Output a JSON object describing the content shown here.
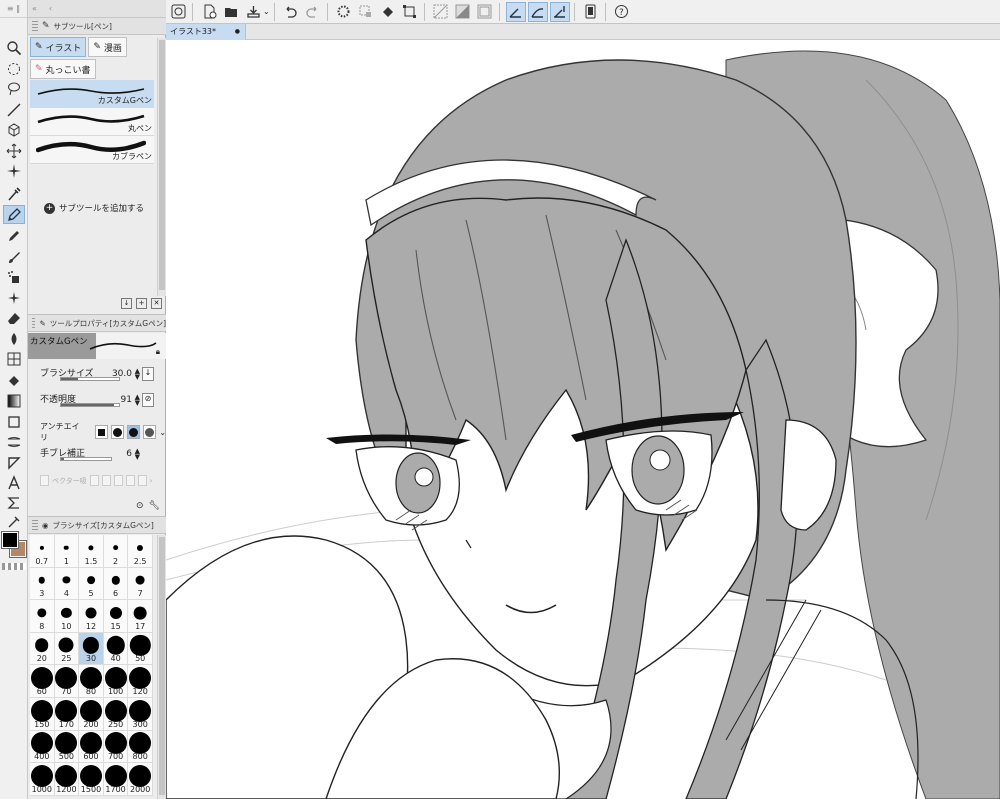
{
  "subtool_panel": {
    "title": "サブツール[ペン]",
    "tabs": [
      {
        "label": "イラスト"
      },
      {
        "label": "漫画"
      },
      {
        "label": "丸っこい書"
      }
    ],
    "brushes": [
      {
        "label": "カスタムGペン"
      },
      {
        "label": "丸ペン"
      },
      {
        "label": "カブラペン"
      }
    ],
    "add_label": "サブツールを追加する"
  },
  "tool_property": {
    "title": "ツールプロパティ[カスタムGペン]",
    "brush_name": "カスタムGペン",
    "brush_size": {
      "label": "ブラシサイズ",
      "value": "30.0",
      "fill": 0.3
    },
    "opacity": {
      "label": "不透明度",
      "value": "91",
      "fill": 0.91
    },
    "antialias": {
      "label": "アンチエイリ"
    },
    "stabilization": {
      "label": "手ブレ補正",
      "value": "6"
    },
    "vector": {
      "label": "ベクター吸"
    }
  },
  "brush_size_panel": {
    "title": "ブラシサイズ[カスタムGペン]",
    "sizes": [
      "0.7",
      "1",
      "1.5",
      "2",
      "2.5",
      "3",
      "4",
      "5",
      "6",
      "7",
      "8",
      "10",
      "12",
      "15",
      "17",
      "20",
      "25",
      "30",
      "40",
      "50",
      "60",
      "70",
      "80",
      "100",
      "120",
      "150",
      "170",
      "200",
      "250",
      "300",
      "400",
      "500",
      "600",
      "700",
      "800",
      "1000",
      "1200",
      "1500",
      "1700",
      "2000"
    ],
    "selected": "30"
  },
  "document": {
    "tab_label": "イラスト33*"
  },
  "colors": {
    "main": "#000000",
    "sub": "#b58766",
    "accent": "#c7dcf0"
  },
  "icons": {
    "tools": [
      "zoom-icon",
      "lasso-icon",
      "selection-icon",
      "line-icon",
      "3d-icon",
      "move-icon",
      "auto-select-icon",
      "eyedropper-icon",
      "pen-icon",
      "pencil-icon",
      "brush-icon",
      "airbrush-icon",
      "decoration-icon",
      "eraser-icon",
      "blend-icon",
      "fill-icon",
      "gradient-icon",
      "figure-icon",
      "frame-icon",
      "ruler-icon",
      "text-icon",
      "balloon-icon",
      "correction-icon"
    ]
  }
}
